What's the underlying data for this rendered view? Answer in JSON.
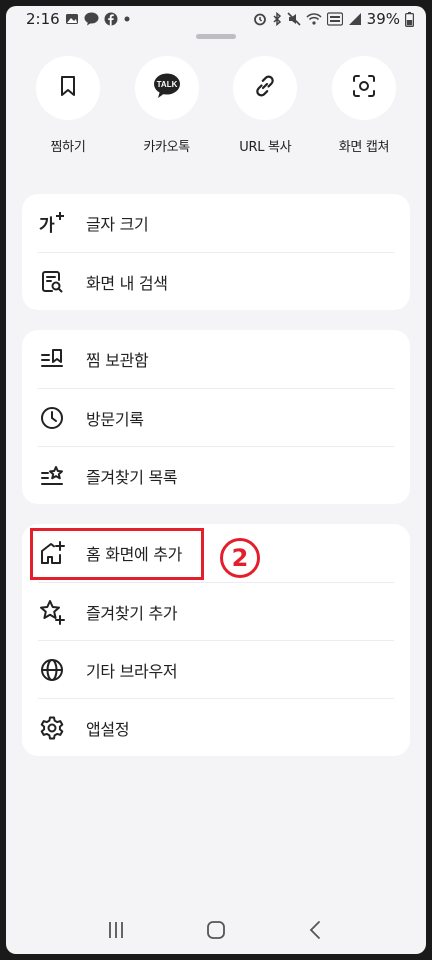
{
  "status_bar": {
    "time": "2:16",
    "battery": "39%",
    "left_icons": [
      "gallery-icon",
      "talk-icon",
      "facebook-icon",
      "dot-icon"
    ],
    "right_icons": [
      "alarm-icon",
      "bluetooth-icon",
      "mute-icon",
      "wifi-icon",
      "volte-icon",
      "signal-icon",
      "battery-icon"
    ]
  },
  "quick_actions": [
    {
      "label": "찜하기",
      "icon": "bookmark-icon"
    },
    {
      "label": "카카오톡",
      "icon": "kakaotalk-icon",
      "badge": "TALK"
    },
    {
      "label": "URL 복사",
      "icon": "link-icon"
    },
    {
      "label": "화면 캡쳐",
      "icon": "screen-capture-icon"
    }
  ],
  "group1": [
    {
      "label": "글자 크기",
      "icon": "text-size-icon",
      "glyph": "가"
    },
    {
      "label": "화면 내 검색",
      "icon": "find-in-page-icon"
    }
  ],
  "group2": [
    {
      "label": "찜 보관함",
      "icon": "saved-list-icon"
    },
    {
      "label": "방문기록",
      "icon": "history-icon"
    },
    {
      "label": "즐겨찾기 목록",
      "icon": "favorites-list-icon"
    }
  ],
  "group3": [
    {
      "label": "홈 화면에 추가",
      "icon": "add-to-home-icon"
    },
    {
      "label": "즐겨찾기 추가",
      "icon": "add-favorite-icon"
    },
    {
      "label": "기타 브라우저",
      "icon": "globe-icon"
    },
    {
      "label": "앱설정",
      "icon": "settings-icon"
    }
  ],
  "annotation": {
    "number": "2",
    "color": "#e21f2b"
  },
  "nav_bar": [
    "recents-icon",
    "home-icon",
    "back-icon"
  ]
}
